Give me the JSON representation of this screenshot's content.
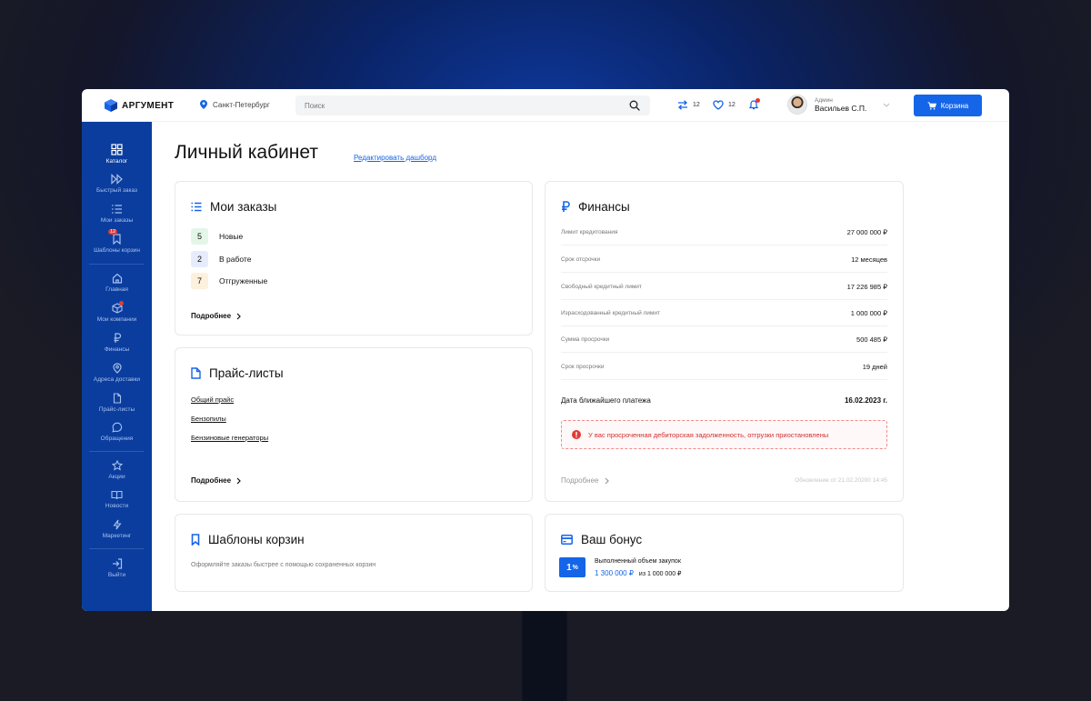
{
  "header": {
    "logo_text": "АРГУМЕНТ",
    "city": "Санкт-Петербург",
    "search_placeholder": "Поиск",
    "compare_count": "12",
    "favorites_count": "12",
    "user": {
      "role": "Админ",
      "name": "Васильев С.П."
    },
    "cart_label": "Корзина"
  },
  "sidebar": {
    "items": [
      {
        "label": "Каталог",
        "icon": "grid-icon"
      },
      {
        "label": "Быстрый заказ",
        "icon": "fast-forward-icon"
      },
      {
        "label": "Мои заказы",
        "icon": "list-icon"
      },
      {
        "label": "Шаблоны корзин",
        "icon": "bookmark-icon",
        "badge": "12"
      },
      {
        "label": "Главная",
        "icon": "home-icon"
      },
      {
        "label": "Мои компании",
        "icon": "box-icon"
      },
      {
        "label": "Финансы",
        "icon": "ruble-icon"
      },
      {
        "label": "Адреса доставки",
        "icon": "location-icon"
      },
      {
        "label": "Прайс-листы",
        "icon": "document-icon"
      },
      {
        "label": "Обращения",
        "icon": "chat-icon"
      },
      {
        "label": "Акции",
        "icon": "star-icon"
      },
      {
        "label": "Новости",
        "icon": "book-icon"
      },
      {
        "label": "Маркетинг",
        "icon": "lightning-icon"
      },
      {
        "label": "Выйти",
        "icon": "logout-icon"
      }
    ]
  },
  "page": {
    "title": "Личный кабинет",
    "edit_link": "Редактировать дашборд"
  },
  "orders": {
    "title": "Мои заказы",
    "rows": [
      {
        "count": "5",
        "label": "Новые",
        "color": "#e3f6e8"
      },
      {
        "count": "2",
        "label": "В работе",
        "color": "#e6ecfb"
      },
      {
        "count": "7",
        "label": "Отгруженные",
        "color": "#fdf0dc"
      }
    ],
    "more": "Подробнее"
  },
  "prices": {
    "title": "Прайс-листы",
    "links": [
      "Общий прайс",
      "Бензопилы",
      "Бензиновые генераторы"
    ],
    "more": "Подробнее"
  },
  "finance": {
    "title": "Финансы",
    "rows": [
      {
        "label": "Лимит кредитования",
        "value": "27 000 000 ₽"
      },
      {
        "label": "Срок отсрочки",
        "value": "12 месяцев"
      },
      {
        "label": "Свободный кредитный лимит",
        "value": "17 226 985 ₽"
      },
      {
        "label": "Израсходованный кредитный лимит",
        "value": "1 000 000 ₽"
      },
      {
        "label": "Сумма просрочки",
        "value": "500 485 ₽"
      },
      {
        "label": "Срок просрочки",
        "value": "19 дней"
      }
    ],
    "next_payment_label": "Дата ближайшего платежа",
    "next_payment_value": "16.02.2023 г.",
    "alert": "У вас просроченная дебиторская задолженность, отгрузки приостановлены",
    "more": "Подробнее",
    "updated": "Обновление от  21.02.20200   14:45"
  },
  "templates": {
    "title": "Шаблоны корзин",
    "description": "Оформляйте заказы быстрее с помощью сохраненных корзин"
  },
  "bonus": {
    "title": "Ваш бонус",
    "percent": "1",
    "percent_sign": "%",
    "label": "Выполненный объем закупок",
    "current": "1 300 000 ₽",
    "of_text": "из 1 000 000 ₽"
  },
  "colors": {
    "accent": "#1565e8",
    "sidebar": "#0a3d9e",
    "danger": "#d32f2f"
  }
}
